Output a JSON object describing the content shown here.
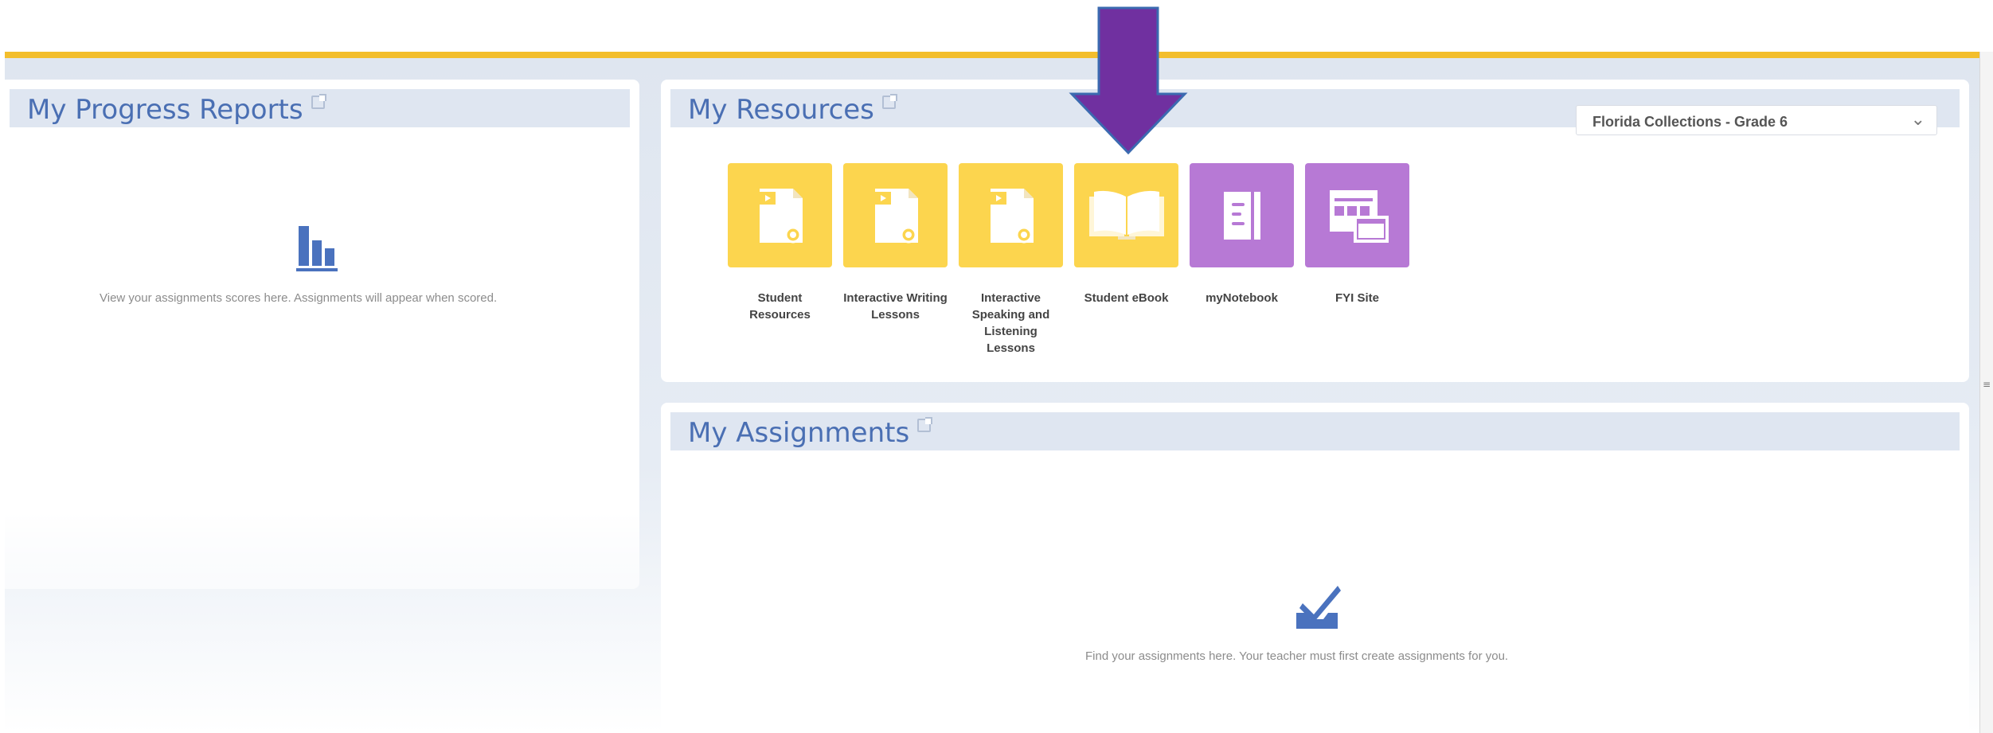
{
  "colors": {
    "accent_yellow": "#f3be2c",
    "title_blue": "#4a6fb3",
    "header_bg": "#dfe6f1",
    "tile_yellow": "#fcd54e",
    "tile_purple": "#b779d5",
    "arrow_purple": "#7030a0"
  },
  "progress": {
    "title": "My Progress Reports",
    "icon": "bar-chart-icon",
    "empty_text": "View your assignments scores here. Assignments will appear when scored."
  },
  "resources": {
    "title": "My Resources",
    "dropdown": {
      "selected": "Florida Collections - Grade 6",
      "icon": "chevron-down-icon"
    },
    "tiles": [
      {
        "label": "Student Resources",
        "icon": "media-document-icon",
        "color": "yellow"
      },
      {
        "label": "Interactive Writing Lessons",
        "icon": "media-document-icon",
        "color": "yellow"
      },
      {
        "label": "Interactive Speaking and Listening Lessons",
        "icon": "media-document-icon",
        "color": "yellow"
      },
      {
        "label": "Student eBook",
        "icon": "open-book-icon",
        "color": "yellow"
      },
      {
        "label": "myNotebook",
        "icon": "notebook-icon",
        "color": "purple"
      },
      {
        "label": "FYI Site",
        "icon": "website-icon",
        "color": "purple"
      }
    ]
  },
  "assignments": {
    "title": "My Assignments",
    "icon": "checkmark-tray-icon",
    "empty_text": "Find your assignments here. Your teacher must first create assignments for you."
  },
  "annotation": {
    "icon": "down-arrow-icon"
  }
}
